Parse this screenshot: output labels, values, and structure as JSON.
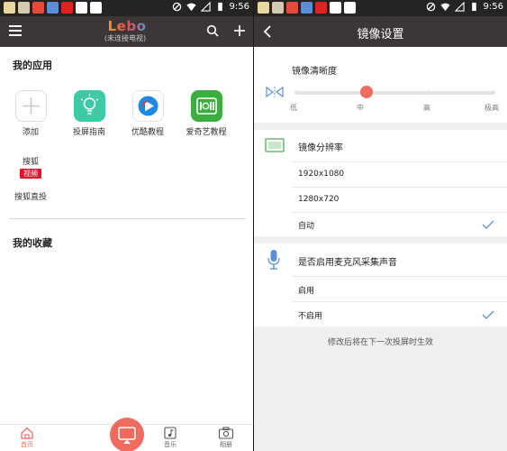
{
  "status_bar": {
    "time": "9:56"
  },
  "left": {
    "app_logo": "Lebo",
    "app_subtitle": "(未连接电视)",
    "my_apps_title": "我的应用",
    "apps": [
      {
        "label": "添加",
        "icon": "add-icon"
      },
      {
        "label": "投屏指南",
        "icon": "lightbulb-icon",
        "color": "#3ec9a7"
      },
      {
        "label": "优酷教程",
        "icon": "youku-icon",
        "color": "#1e88e5"
      },
      {
        "label": "爱奇艺教程",
        "icon": "iqiyi-icon",
        "color": "#3cae3f"
      },
      {
        "label": "搜狐直投",
        "icon": "sohu-icon",
        "logo_top": "搜狐",
        "logo_bottom": "视频",
        "color": "#e0142c"
      }
    ],
    "favorites_title": "我的收藏",
    "tabs": [
      {
        "label": "首页",
        "icon": "home-icon",
        "active": true
      },
      {
        "label": "音乐",
        "icon": "music-icon"
      },
      {
        "label": "相册",
        "icon": "camera-icon"
      }
    ],
    "cast_button_icon": "tv-cast-icon"
  },
  "right": {
    "title": "镜像设置",
    "clarity": {
      "title": "镜像清晰度",
      "ticks": [
        "低",
        "中",
        "高",
        "极高"
      ],
      "selected_index": 1
    },
    "resolution": {
      "title": "镜像分辨率",
      "options": [
        "1920x1080",
        "1280x720",
        "自动"
      ],
      "selected": "自动"
    },
    "microphone": {
      "title": "是否启用麦克风采集声音",
      "options": [
        "启用",
        "不启用"
      ],
      "selected": "不启用"
    },
    "footer_note": "修改后将在下一次投屏时生效"
  },
  "colors": {
    "accent": "#f06a5e",
    "appbar": "#3d3636",
    "statusbar": "#262323",
    "check": "#5b8ed6",
    "screen_icon": "#4caf50",
    "mic_icon": "#5c8fd6"
  }
}
